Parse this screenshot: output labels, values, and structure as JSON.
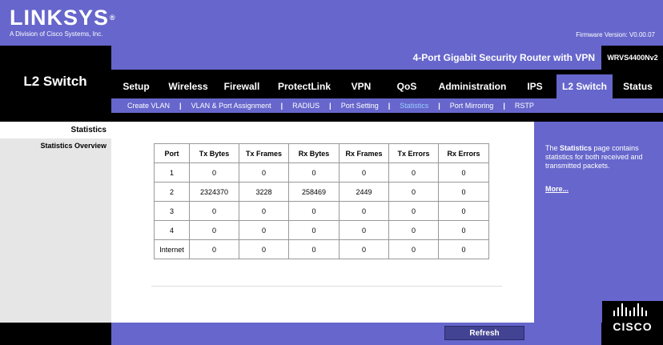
{
  "brand": {
    "logo_text": "LINKSYS",
    "logo_mark": "®",
    "subtitle": "A Division of Cisco Systems, Inc.",
    "firmware": "Firmware Version: V0.00.07"
  },
  "header": {
    "section_title": "L2 Switch",
    "product_name": "4-Port Gigabit Security Router with VPN",
    "model": "WRVS4400Nv2"
  },
  "tabs": [
    {
      "label": "Setup"
    },
    {
      "label": "Wireless"
    },
    {
      "label": "Firewall"
    },
    {
      "label": "ProtectLink"
    },
    {
      "label": "VPN"
    },
    {
      "label": "QoS"
    },
    {
      "label": "Administration"
    },
    {
      "label": "IPS"
    },
    {
      "label": "L2 Switch"
    },
    {
      "label": "Status"
    }
  ],
  "subtabs": [
    {
      "label": "Create VLAN"
    },
    {
      "label": "VLAN & Port Assignment"
    },
    {
      "label": "RADIUS"
    },
    {
      "label": "Port Setting"
    },
    {
      "label": "Statistics"
    },
    {
      "label": "Port Mirroring"
    },
    {
      "label": "RSTP"
    }
  ],
  "sidebar": {
    "heading": "Statistics",
    "item": "Statistics Overview"
  },
  "table": {
    "headers": [
      "Port",
      "Tx Bytes",
      "Tx Frames",
      "Rx Bytes",
      "Rx Frames",
      "Tx Errors",
      "Rx Errors"
    ],
    "rows": [
      [
        "1",
        "0",
        "0",
        "0",
        "0",
        "0",
        "0"
      ],
      [
        "2",
        "2324370",
        "3228",
        "258469",
        "2449",
        "0",
        "0"
      ],
      [
        "3",
        "0",
        "0",
        "0",
        "0",
        "0",
        "0"
      ],
      [
        "4",
        "0",
        "0",
        "0",
        "0",
        "0",
        "0"
      ],
      [
        "Internet",
        "0",
        "0",
        "0",
        "0",
        "0",
        "0"
      ]
    ]
  },
  "help": {
    "intro": "The ",
    "term": "Statistics",
    "rest": " page contains statistics for both received and transmitted packets.",
    "more": "More..."
  },
  "footer": {
    "refresh_label": "Refresh",
    "cisco_label": "CISCO"
  },
  "colors": {
    "accent_purple": "#6666cc",
    "active_subtab": "#99ccff",
    "button_bg": "#434393"
  }
}
